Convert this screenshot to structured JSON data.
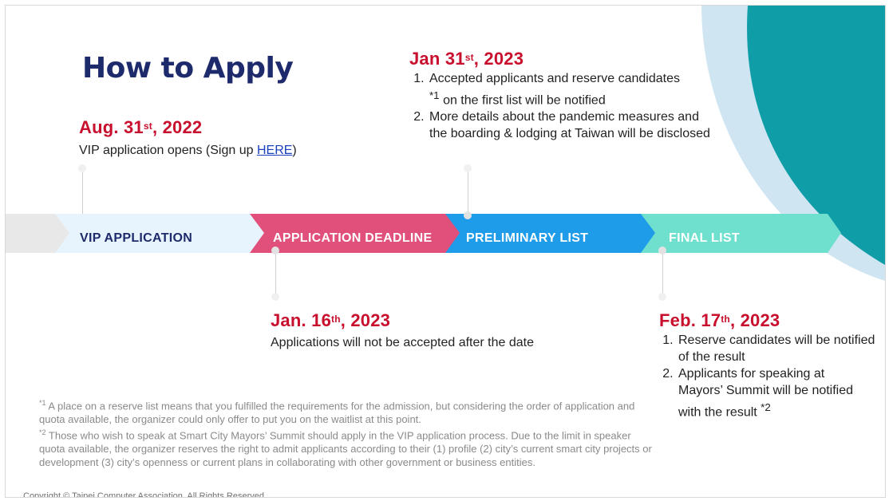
{
  "title": "How to Apply",
  "colors": {
    "title": "#1d2a6b",
    "date_red": "#c8102e",
    "stage_vip": "#e8f4fd",
    "stage_deadline": "#e0507a",
    "stage_preliminary": "#1e9be9",
    "stage_final": "#6fe0cd",
    "deco_teal": "#0f9da8",
    "deco_lightblue": "#cfe6f2"
  },
  "timeline": {
    "stages": [
      {
        "label": "VIP APPLICATION"
      },
      {
        "label": "APPLICATION DEADLINE"
      },
      {
        "label": "PRELIMINARY LIST"
      },
      {
        "label": "FINAL LIST"
      }
    ]
  },
  "milestones": {
    "aug": {
      "date_main": "Aug. 31",
      "date_sup": "st",
      "date_year": ", 2022",
      "desc_prefix": "VIP application opens (Sign up ",
      "desc_link": "HERE",
      "desc_suffix": ")"
    },
    "jan31": {
      "date_main": "Jan 31",
      "date_sup": "st",
      "date_year": ", 2023",
      "items": [
        {
          "text_a": "Accepted applicants and reserve candidates",
          "ref": "*1",
          "text_b": "on the first list will be notified"
        },
        {
          "text": "More details about the pandemic measures and the boarding & lodging at Taiwan will be disclosed"
        }
      ]
    },
    "jan16": {
      "date_main": "Jan. 16",
      "date_sup": "th",
      "date_year": ", 2023",
      "desc": "Applications will not be accepted after the date"
    },
    "feb17": {
      "date_main": "Feb. 17",
      "date_sup": "th",
      "date_year": ", 2023",
      "items": [
        {
          "text": "Reserve candidates will be notified of the result"
        },
        {
          "text": "Applicants for speaking at Mayors’ Summit will be notified with the result",
          "ref": "*2"
        }
      ]
    }
  },
  "footnotes": [
    {
      "ref": "*1",
      "text": "A place on a reserve list means that you fulfilled the requirements for the admission, but considering the order of application and quota available, the organizer could only offer to put you on the waitlist at this point."
    },
    {
      "ref": "*2",
      "text": "Those who wish to speak at Smart City Mayors’ Summit should apply in the VIP application process. Due to the limit in speaker quota available, the organizer reserves the right to admit applicants according to their (1) profile (2) city’s current smart city projects or development (3) city’s openness or current plans in collaborating with other government or business entities."
    }
  ],
  "copyright": "Copyright © Taipei Computer Association. All Rights Reserved."
}
